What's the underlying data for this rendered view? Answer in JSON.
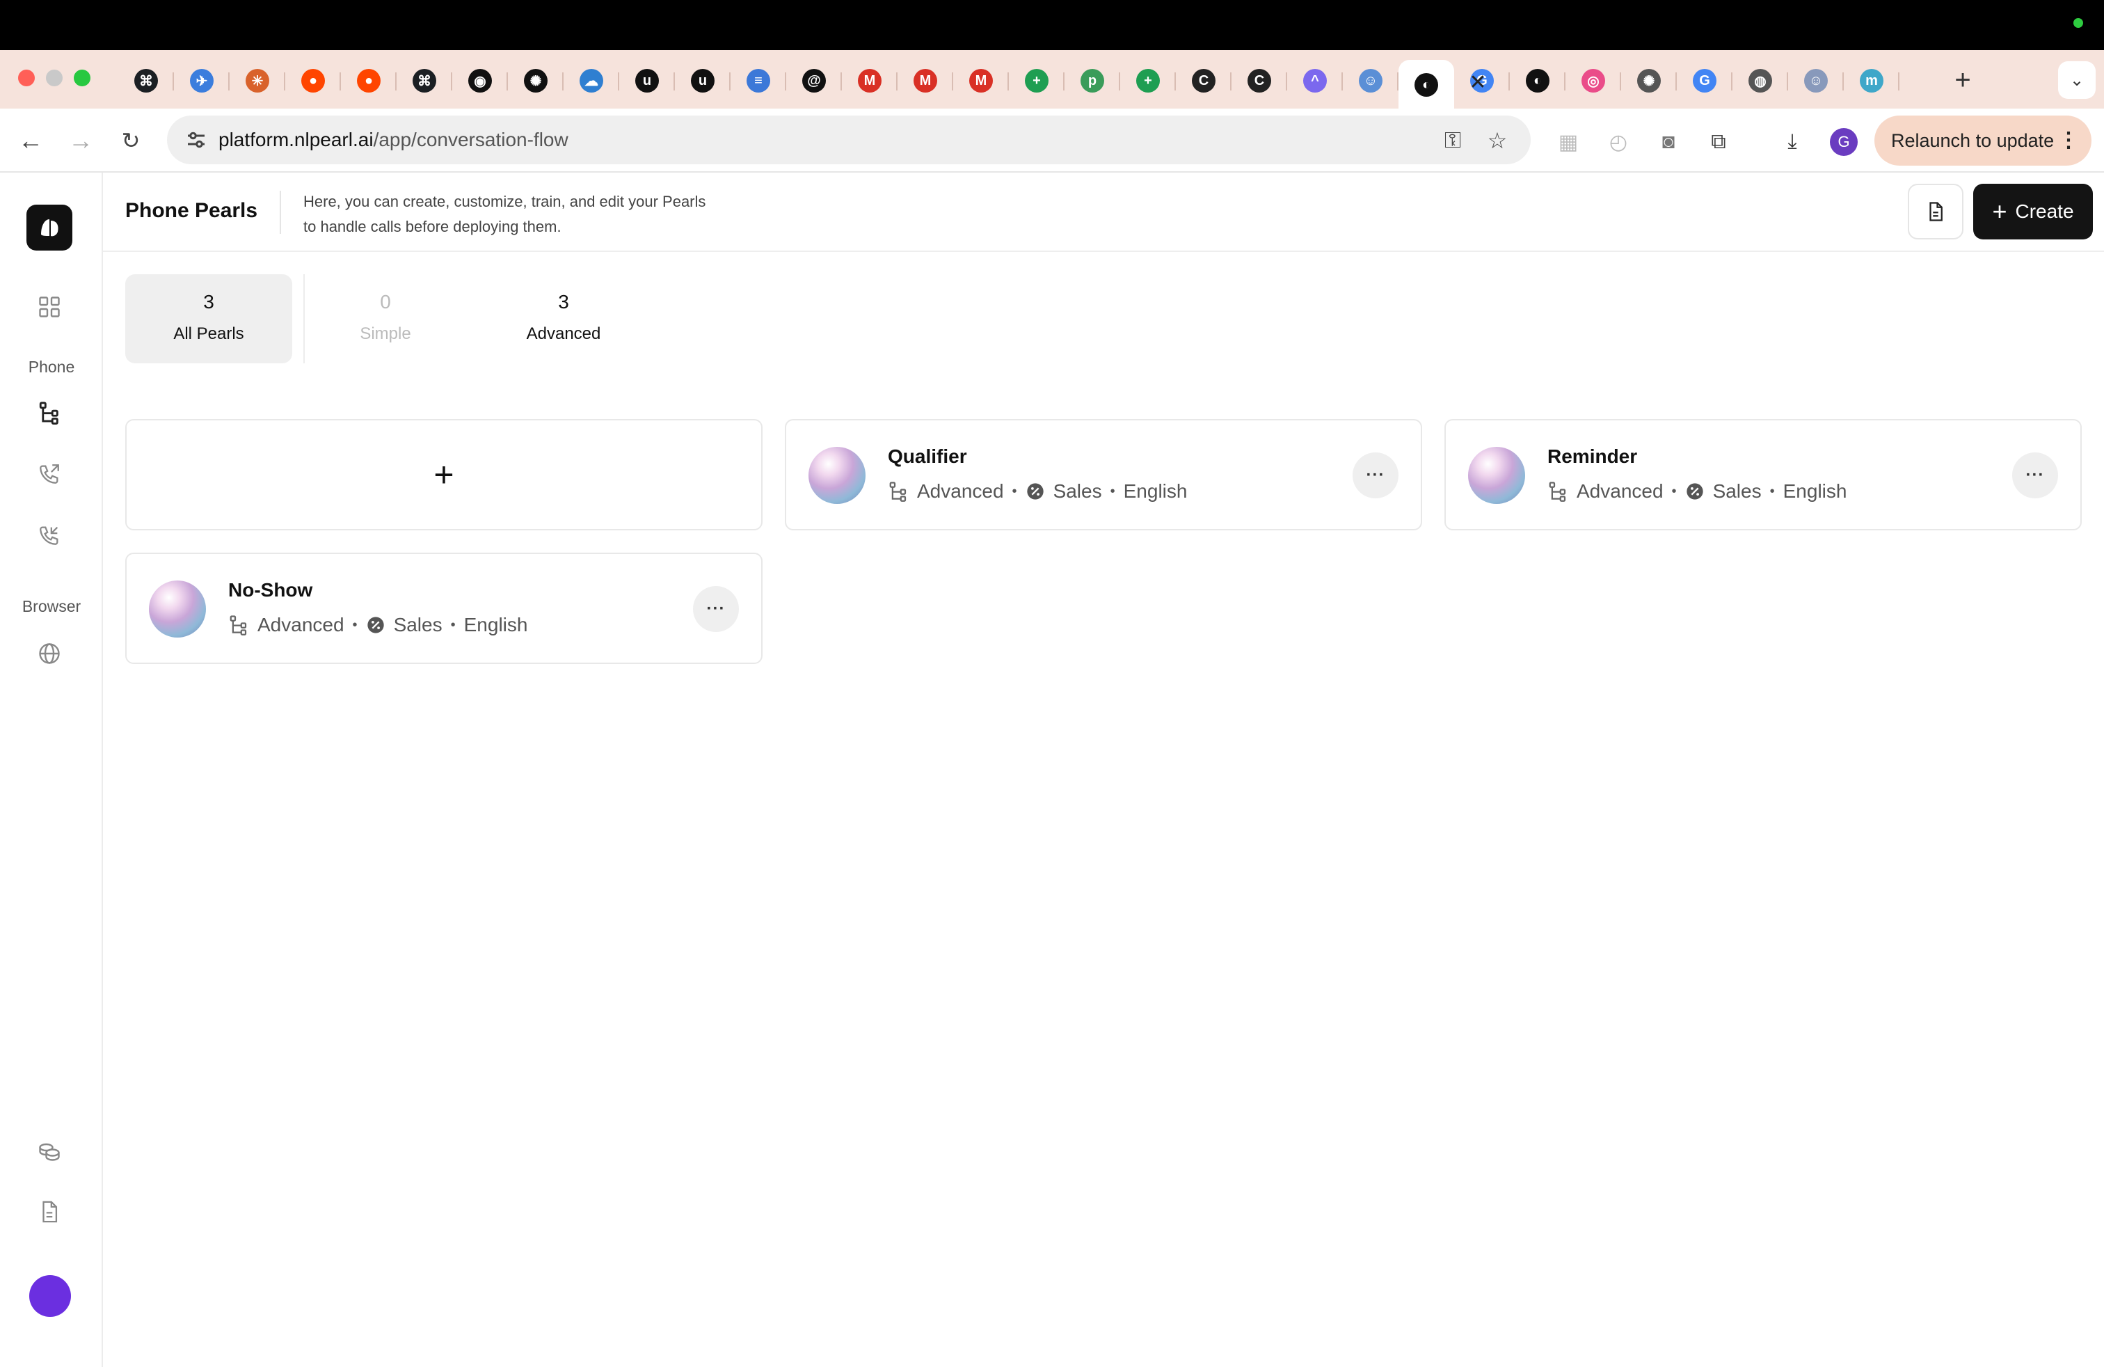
{
  "browser": {
    "url_host": "platform.nlpearl.ai",
    "url_path": "/app/conversation-flow",
    "relaunch_label": "Relaunch to update",
    "profile_initial": "G",
    "tabs": [
      {
        "icon": "github-icon",
        "color": "#1b1f23",
        "glyph": "⌘"
      },
      {
        "icon": "bird-icon",
        "color": "#3b7ddd",
        "glyph": "✈"
      },
      {
        "icon": "claude-icon",
        "color": "#d9622b",
        "glyph": "✳"
      },
      {
        "icon": "reddit-icon",
        "color": "#ff4500",
        "glyph": "●"
      },
      {
        "icon": "reddit-icon",
        "color": "#ff4500",
        "glyph": "●"
      },
      {
        "icon": "github-icon",
        "color": "#1b1f23",
        "glyph": "⌘"
      },
      {
        "icon": "circle-icon",
        "color": "#111111",
        "glyph": "◉"
      },
      {
        "icon": "openai-icon",
        "color": "#111111",
        "glyph": "✺"
      },
      {
        "icon": "cloud-icon",
        "color": "#2f7fd1",
        "glyph": "☁"
      },
      {
        "icon": "upwork-icon",
        "color": "#111111",
        "glyph": "u"
      },
      {
        "icon": "upwork-icon",
        "color": "#111111",
        "glyph": "u"
      },
      {
        "icon": "docs-icon",
        "color": "#3c78d8",
        "glyph": "≡"
      },
      {
        "icon": "threads-icon",
        "color": "#111111",
        "glyph": "@"
      },
      {
        "icon": "gmail-icon",
        "color": "#d93025",
        "glyph": "M"
      },
      {
        "icon": "gmail-icon",
        "color": "#d93025",
        "glyph": "M"
      },
      {
        "icon": "gmail-icon",
        "color": "#d93025",
        "glyph": "M"
      },
      {
        "icon": "sheets-icon",
        "color": "#1e9e52",
        "glyph": "+"
      },
      {
        "icon": "p-icon",
        "color": "#3a9c5a",
        "glyph": "p"
      },
      {
        "icon": "sheets-icon",
        "color": "#1e9e52",
        "glyph": "+"
      },
      {
        "icon": "c-icon",
        "color": "#222222",
        "glyph": "C"
      },
      {
        "icon": "c-icon",
        "color": "#222222",
        "glyph": "C"
      },
      {
        "icon": "clickup-icon",
        "color": "#7b68ee",
        "glyph": "^"
      },
      {
        "icon": "bot-icon",
        "color": "#5b8fd6",
        "glyph": "☺"
      },
      {
        "icon": "pearl-icon",
        "color": "#111111",
        "glyph": "◐",
        "active": true
      },
      {
        "icon": "google-icon",
        "color": "#4285f4",
        "glyph": "G"
      },
      {
        "icon": "pearl-icon",
        "color": "#111111",
        "glyph": "◐"
      },
      {
        "icon": "dribbble-icon",
        "color": "#ea4c89",
        "glyph": "◎"
      },
      {
        "icon": "openai-icon",
        "color": "#555555",
        "glyph": "✺"
      },
      {
        "icon": "google-icon",
        "color": "#4285f4",
        "glyph": "G"
      },
      {
        "icon": "globe-icon",
        "color": "#555555",
        "glyph": "◍"
      },
      {
        "icon": "bot-icon",
        "color": "#8899bb",
        "glyph": "☺"
      },
      {
        "icon": "m-icon",
        "color": "#3fa7c9",
        "glyph": "m"
      }
    ]
  },
  "sidebar": {
    "phone_label": "Phone",
    "browser_label": "Browser"
  },
  "header": {
    "title": "Phone Pearls",
    "description_line1": "Here, you can create, customize, train, and edit your Pearls",
    "description_line2": "to handle calls before deploying them.",
    "create_label": "Create"
  },
  "filters": [
    {
      "count": "3",
      "label": "All Pearls"
    },
    {
      "count": "0",
      "label": "Simple"
    },
    {
      "count": "3",
      "label": "Advanced"
    }
  ],
  "add_card": {
    "symbol": "+"
  },
  "pearls": [
    {
      "name": "Qualifier",
      "type": "Advanced",
      "category": "Sales",
      "language": "English"
    },
    {
      "name": "Reminder",
      "type": "Advanced",
      "category": "Sales",
      "language": "English"
    },
    {
      "name": "No-Show",
      "type": "Advanced",
      "category": "Sales",
      "language": "English"
    }
  ],
  "menu_symbol": "···",
  "bullet": "•",
  "colors": {
    "accent_dark": "#141414",
    "avatar": "#6b2fe0",
    "tab_strip": "#f6e3dc",
    "relaunch": "#f7d8c8"
  }
}
